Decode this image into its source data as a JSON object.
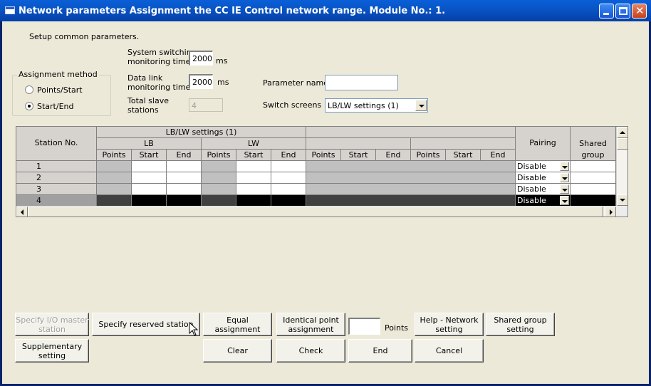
{
  "window": {
    "title": "Network parameters  Assignment the CC IE Control network range. Module No.: 1."
  },
  "setup_text": "Setup common parameters.",
  "switching": {
    "label_line1": "System switching",
    "label_line2": "monitoring time",
    "value": "2000",
    "unit": "ms"
  },
  "datalink": {
    "label_line1": "Data link",
    "label_line2": "monitoring time",
    "value": "2000",
    "unit": "ms"
  },
  "total_slave": {
    "label_line1": "Total slave",
    "label_line2": "stations",
    "value": "4"
  },
  "parameter_name": {
    "label": "Parameter name",
    "value": ""
  },
  "switch_screens": {
    "label": "Switch screens",
    "value": "LB/LW settings (1)"
  },
  "assignment": {
    "title": "Assignment method",
    "options": [
      "Points/Start",
      "Start/End"
    ],
    "selected": "Start/End"
  },
  "grid": {
    "station_header": "Station No.",
    "group_header": "LB/LW settings (1)",
    "lb": "LB",
    "lw": "LW",
    "col_points": "Points",
    "col_start": "Start",
    "col_end": "End",
    "pairing_header": "Pairing",
    "shared_header_1": "Shared",
    "shared_header_2": "group",
    "rows": [
      {
        "station": "1",
        "pairing": "Disable"
      },
      {
        "station": "2",
        "pairing": "Disable"
      },
      {
        "station": "3",
        "pairing": "Disable"
      },
      {
        "station": "4",
        "pairing": "Disable"
      }
    ]
  },
  "buttons": {
    "specify_io_master": "Specify I/O master\nstation",
    "specify_reserved": "Specify reserved station",
    "equal_assignment": "Equal assignment",
    "identical_point": "Identical point\nassignment",
    "points_label": "Points",
    "points_value": "",
    "help_network": "Help - Network\nsetting",
    "shared_group": "Shared group\nsetting",
    "supplementary": "Supplementary\nsetting",
    "clear": "Clear",
    "check": "Check",
    "end": "End",
    "cancel": "Cancel"
  }
}
